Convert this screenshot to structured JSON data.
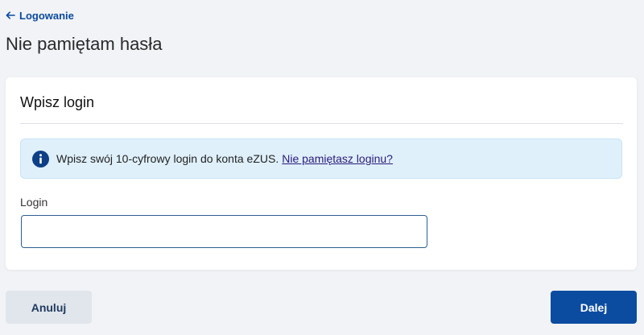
{
  "nav": {
    "back_label": "Logowanie",
    "back_icon": "arrow-left-icon"
  },
  "page": {
    "title": "Nie pamiętam hasła"
  },
  "card": {
    "title": "Wpisz login",
    "info": {
      "icon": "info-icon",
      "text": "Wpisz swój 10-cyfrowy login do konta eZUS.",
      "link_text": "Nie pamiętasz loginu?"
    },
    "field": {
      "label": "Login",
      "value": "",
      "placeholder": ""
    }
  },
  "actions": {
    "cancel_label": "Anuluj",
    "next_label": "Dalej"
  },
  "colors": {
    "accent": "#0c4ca0",
    "link": "#0b4a9e",
    "info_background": "#dff0fb",
    "page_background": "#f1f3f7"
  }
}
